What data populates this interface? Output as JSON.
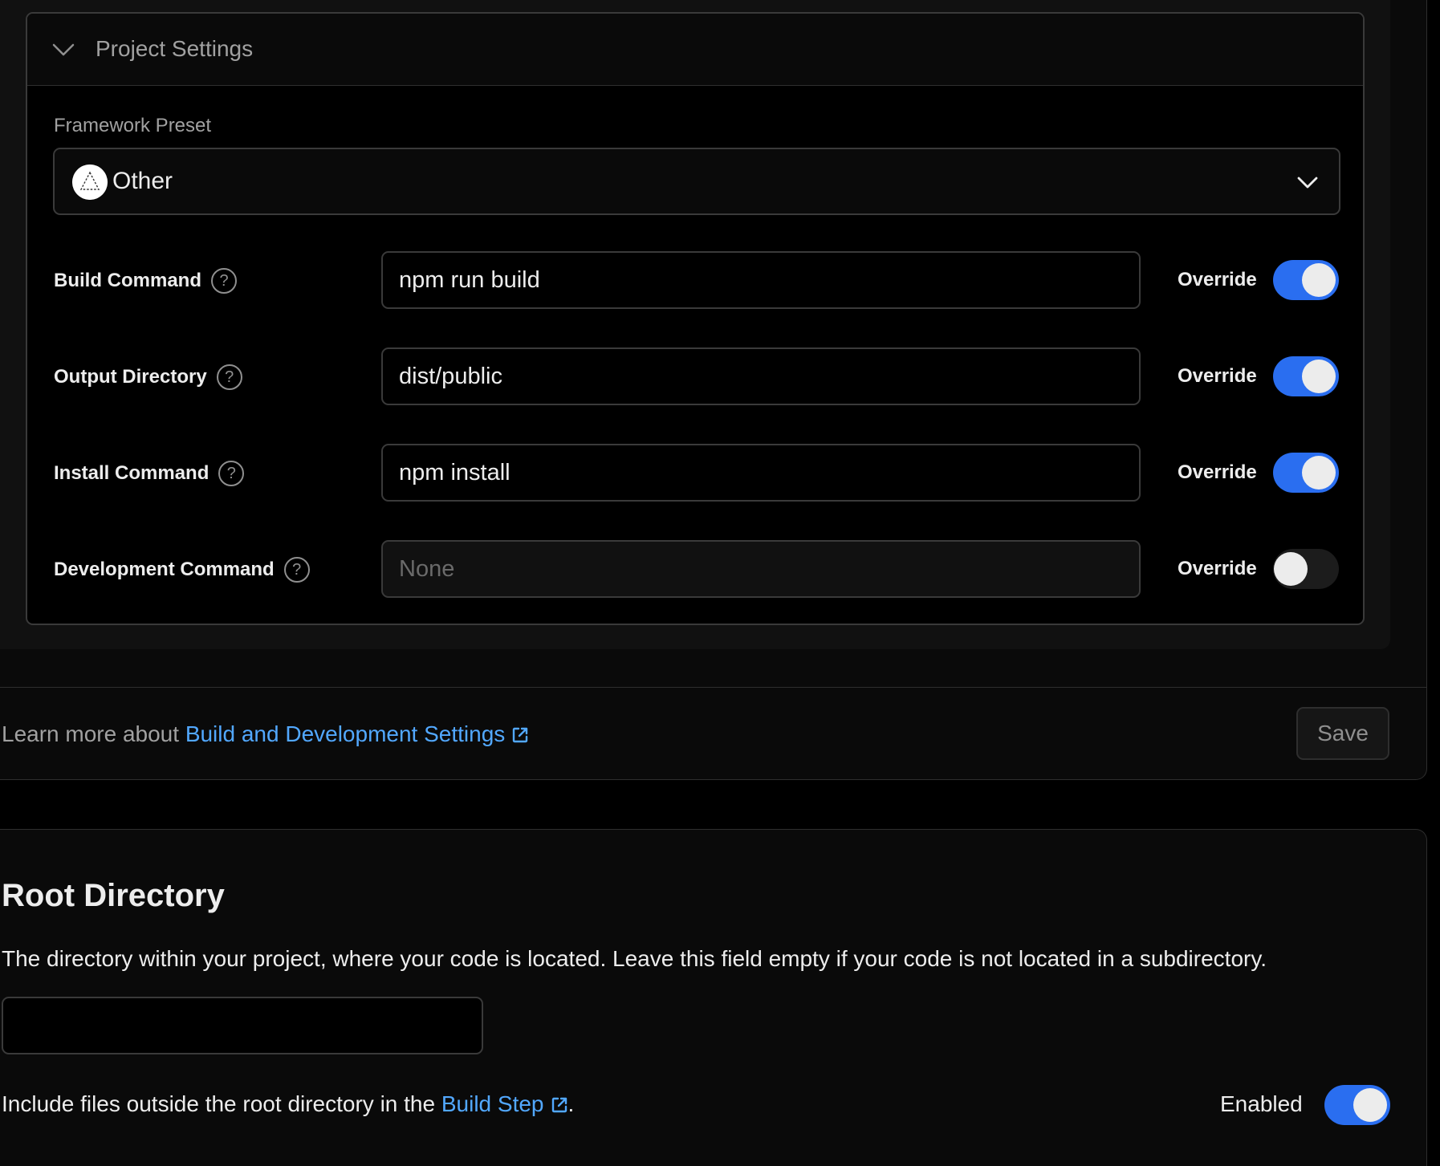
{
  "project_settings": {
    "title": "Project Settings",
    "framework_preset": {
      "label": "Framework Preset",
      "value": "Other",
      "icon": "framework-other-icon"
    },
    "rows": [
      {
        "label": "Build Command",
        "value": "npm run build",
        "placeholder": "",
        "override_label": "Override",
        "override": true
      },
      {
        "label": "Output Directory",
        "value": "dist/public",
        "placeholder": "",
        "override_label": "Override",
        "override": true
      },
      {
        "label": "Install Command",
        "value": "npm install",
        "placeholder": "",
        "override_label": "Override",
        "override": true
      },
      {
        "label": "Development Command",
        "value": "",
        "placeholder": "None",
        "override_label": "Override",
        "override": false
      }
    ]
  },
  "footer": {
    "learn_more_prefix": "Learn more about ",
    "learn_more_link": "Build and Development Settings",
    "save_label": "Save"
  },
  "root_directory": {
    "title": "Root Directory",
    "description": "The directory within your project, where your code is located. Leave this field empty if your code is not located in a subdirectory.",
    "value": "",
    "include_prefix": "Include files outside the root directory in the ",
    "include_link": "Build Step",
    "include_suffix": ".",
    "enabled_label": "Enabled",
    "enabled": true
  },
  "colors": {
    "accent": "#2a6ef0",
    "link": "#52a8ff",
    "background": "#000000"
  }
}
